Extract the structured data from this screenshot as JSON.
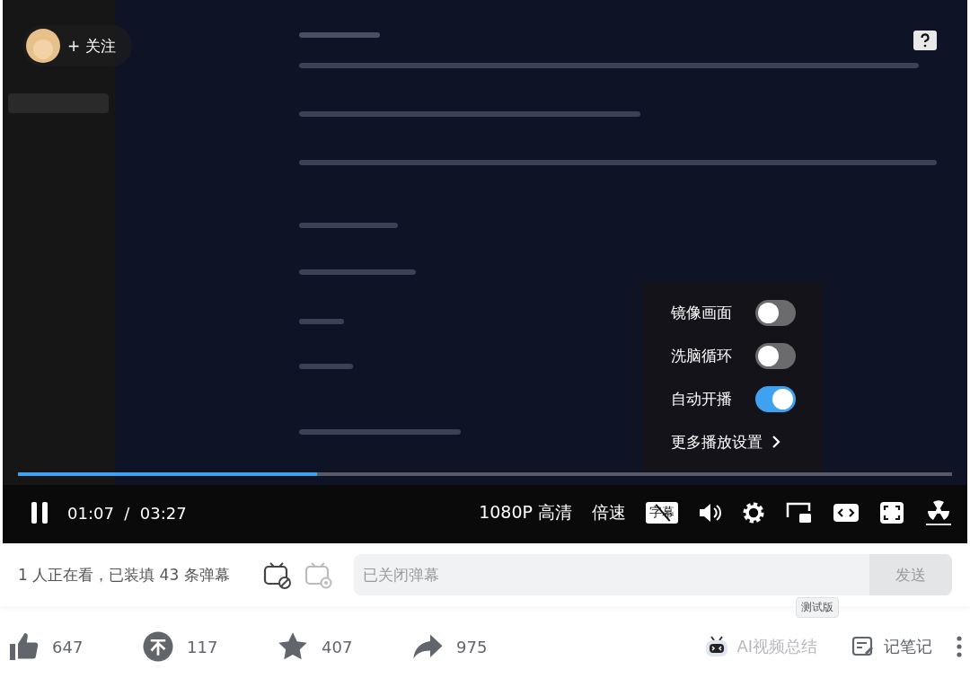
{
  "player": {
    "follow": {
      "label": "+ 关注"
    },
    "settings_menu": [
      {
        "label": "镜像画面",
        "kind": "toggle",
        "on": false
      },
      {
        "label": "洗脑循环",
        "kind": "toggle",
        "on": false
      },
      {
        "label": "自动开播",
        "kind": "toggle",
        "on": true
      },
      {
        "label": "更多播放设置",
        "kind": "link"
      }
    ],
    "progress": {
      "level": 0.32
    },
    "playing": true,
    "time": {
      "current": "01:07",
      "separator": "/",
      "total": "03:27"
    },
    "quality": "1080P 高清",
    "speed": "倍速",
    "subtitle": {
      "label": "字幕",
      "on": false
    }
  },
  "danmaku_bar": {
    "status": "1 人正在看，已装填 43 条弹幕",
    "danmaku_on": false,
    "placeholder": "已关闭弹幕",
    "send": "发送"
  },
  "actions": [
    {
      "kind": "like",
      "count": "647"
    },
    {
      "kind": "coin",
      "count": "117"
    },
    {
      "kind": "favorite",
      "count": "407"
    },
    {
      "kind": "share",
      "count": "975"
    }
  ],
  "ai_summary": {
    "label": "AI视频总结",
    "badge": "测试版"
  },
  "notes": {
    "label": "记笔记"
  }
}
